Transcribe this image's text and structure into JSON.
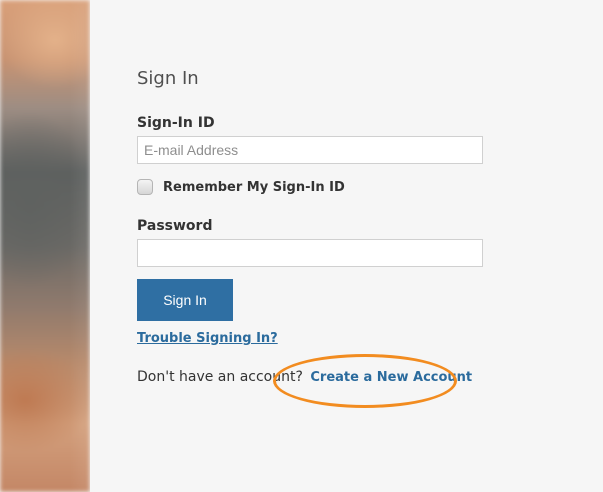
{
  "form": {
    "heading": "Sign In",
    "signin_id_label": "Sign-In ID",
    "email_placeholder": "E-mail Address",
    "remember_label": "Remember My Sign-In ID",
    "remember_checked": false,
    "password_label": "Password",
    "password_value": "",
    "signin_button_label": "Sign In",
    "trouble_link": "Trouble Signing In?",
    "account_prompt": "Don't have an account?",
    "create_account_link": "Create a New Account"
  },
  "colors": {
    "background": "#f6f6f6",
    "button": "#2f6fa3",
    "link": "#2b6b9d",
    "highlight": "#f28c20"
  }
}
